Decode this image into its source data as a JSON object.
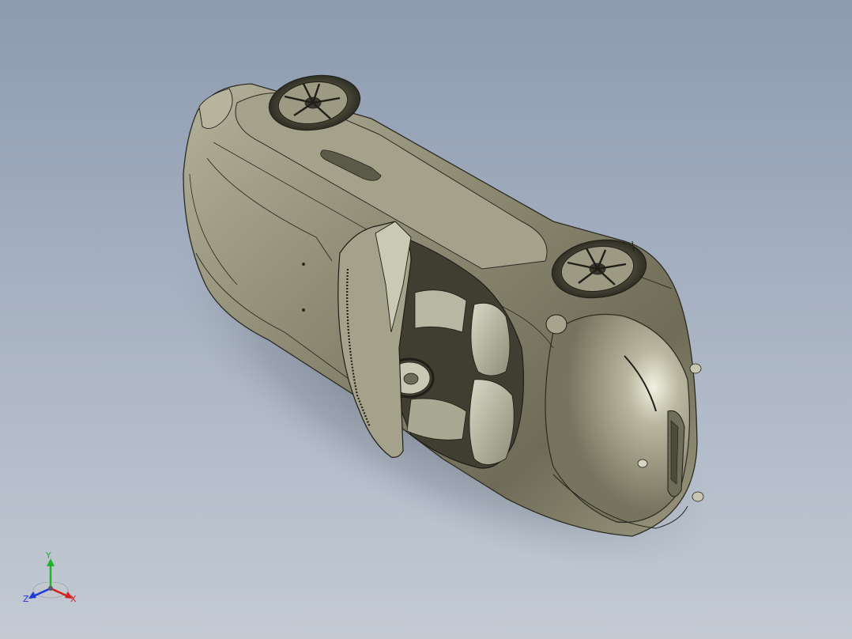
{
  "viewport": {
    "background_top": "#8d9bb0",
    "background_bottom": "#c3cad4",
    "model_color": "#8a8a72",
    "model": "car-body"
  },
  "triad": {
    "x_label": "X",
    "y_label": "Y",
    "z_label": "Z",
    "x_color": "#d42020",
    "y_color": "#21b42a",
    "z_color": "#1f36d8"
  }
}
